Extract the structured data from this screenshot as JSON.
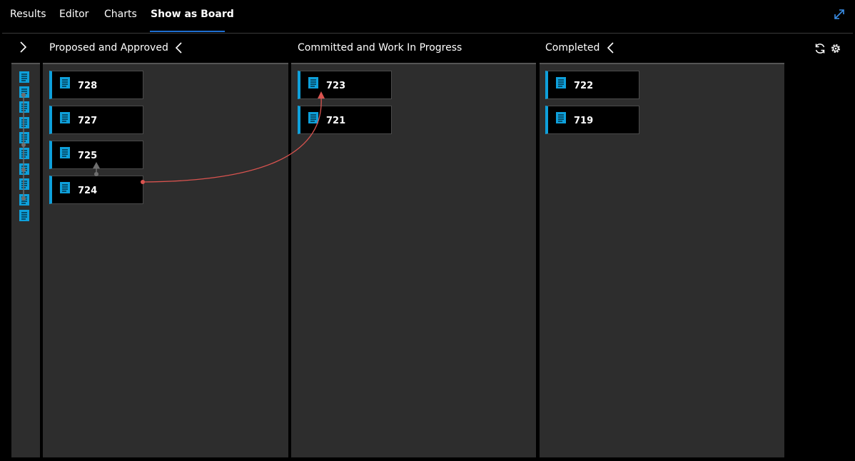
{
  "tabs": [
    {
      "label": "Results"
    },
    {
      "label": "Editor"
    },
    {
      "label": "Charts"
    },
    {
      "label": "Show as Board",
      "active": true
    }
  ],
  "columns": [
    {
      "title": "Proposed and Approved",
      "cards": [
        "728",
        "727",
        "725",
        "724"
      ]
    },
    {
      "title": "Committed and Work In Progress",
      "cards": [
        "723",
        "721"
      ]
    },
    {
      "title": "Completed",
      "cards": [
        "722",
        "719"
      ]
    }
  ],
  "icons": {
    "expand": "expand-diagonal-icon",
    "refresh": "refresh-icon",
    "settings": "gear-icon",
    "collapse_toggle": "chevron-right-icon",
    "card": "document-icon"
  },
  "colors": {
    "background": "#000000",
    "column": "#2d2d2d",
    "accent": "#0ea0db",
    "tab_underline": "#1f6fd1",
    "link_red": "#d9534f",
    "link_gray": "#6e6e6e"
  },
  "links": [
    {
      "from": "724",
      "to": "723",
      "color": "red"
    },
    {
      "from": "724",
      "to": "725",
      "color": "gray"
    }
  ]
}
